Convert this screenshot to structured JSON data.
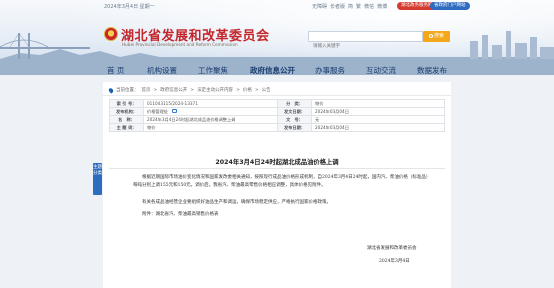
{
  "header": {
    "date": "2024年3月4日 星期一",
    "top_links": [
      "无障碍",
      "长者版",
      "简",
      "繁",
      "微信",
      "微博"
    ],
    "pill_red": "湖北政务服务网",
    "pill_blue": "省政府门户网站",
    "site_title": "湖北省发展和改革委员会",
    "site_subtitle": "Hubei Provincial Development and Reform Commission",
    "search_placeholder": "请输入关键字",
    "search_button": "搜索"
  },
  "nav": {
    "items": [
      "首 页",
      "机构设置",
      "工作聚焦",
      "政府信息公开",
      "办事服务",
      "互动交流",
      "数据发布"
    ],
    "active_index": 3
  },
  "breadcrumb": {
    "prefix": "当前位置：",
    "items": [
      "首页",
      "政府信息公开",
      "法定主动公开内容",
      "价格",
      "公告"
    ],
    "separator": ">"
  },
  "meta": {
    "rows": [
      {
        "k1": "索 引 号：",
        "v1": "011043115/2024-13371",
        "k2": "分　类：",
        "v2": "物价"
      },
      {
        "k1": "发布机构：",
        "v1": "价格管理处",
        "k2": "发文日期：",
        "v2": "2024年03月04日"
      },
      {
        "k1": "名　称：",
        "v1": "2024年3月4日24时起湖北成品油价格调整上调",
        "k2": "文　号：",
        "v2": "无"
      },
      {
        "k1": "主 题 词：",
        "v1": "物价",
        "k2": "发布日期：",
        "v2": "2024年03月04日"
      }
    ]
  },
  "document": {
    "title": "2024年3月4日24时起湖北成品油价格上调",
    "para1": "根据近期国际市场油价变化情况和国家发改委相关通知，按照现行成品油价格形成机制，自2024年3月4日24时起，国内汽、柴油价格（标准品）每吨分别上调155元和150元。调价后，我省汽、柴油最高零售价格相应调整，具体价格见附件。",
    "para2": "有关各成品油经营企业要组织好油品生产和调运，确保市场稳定供应，严格执行国家价格政策。",
    "para3": "附件：湖北省汽、柴油最高销售价格表",
    "sign_org": "湖北省发展和改革委员会",
    "sign_date": "2024年3月4日"
  },
  "sidetab": "主题分类",
  "colors": {
    "brand_red": "#c4262b",
    "nav_blue": "#1b3d6e",
    "search_orange": "#f3a81c",
    "accent_blue": "#2e6cc0"
  }
}
